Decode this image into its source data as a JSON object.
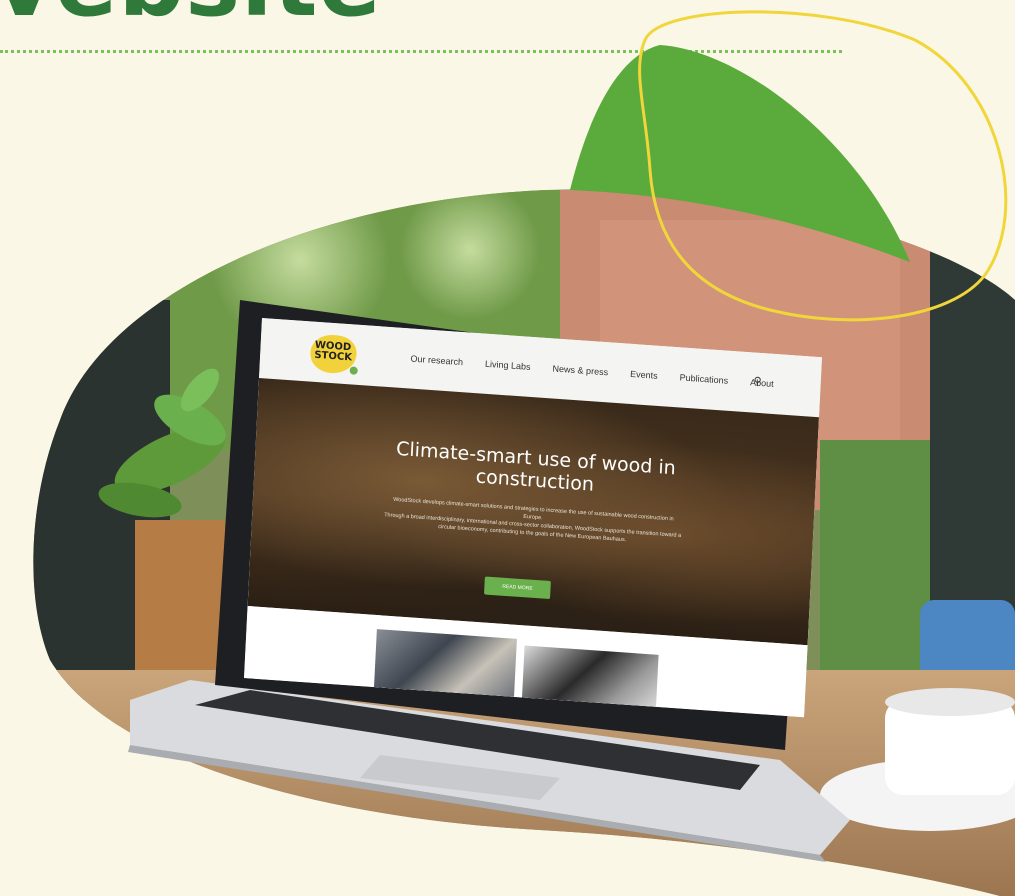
{
  "page": {
    "heading": "vebsite"
  },
  "website": {
    "logo_text": "WOOD STOCK",
    "nav": [
      "Our research",
      "Living Labs",
      "News & press",
      "Events",
      "Publications",
      "About"
    ],
    "hero": {
      "title": "Climate-smart use of wood in construction",
      "paragraph_1": "WoodStock develops climate-smart solutions and strategies to increase the use of sustainable wood construction in Europe.",
      "paragraph_2": "Through a broad interdisciplinary, international and cross-sector collaboration, WoodStock supports the transition toward a circular bioeconomy, contributing to the goals of the New European Bauhaus.",
      "button_label": "READ MORE"
    }
  },
  "colors": {
    "background": "#fbf7e6",
    "accent_green": "#5aaa3c",
    "accent_yellow": "#f0d63a",
    "heading_green": "#2f7a3a"
  }
}
